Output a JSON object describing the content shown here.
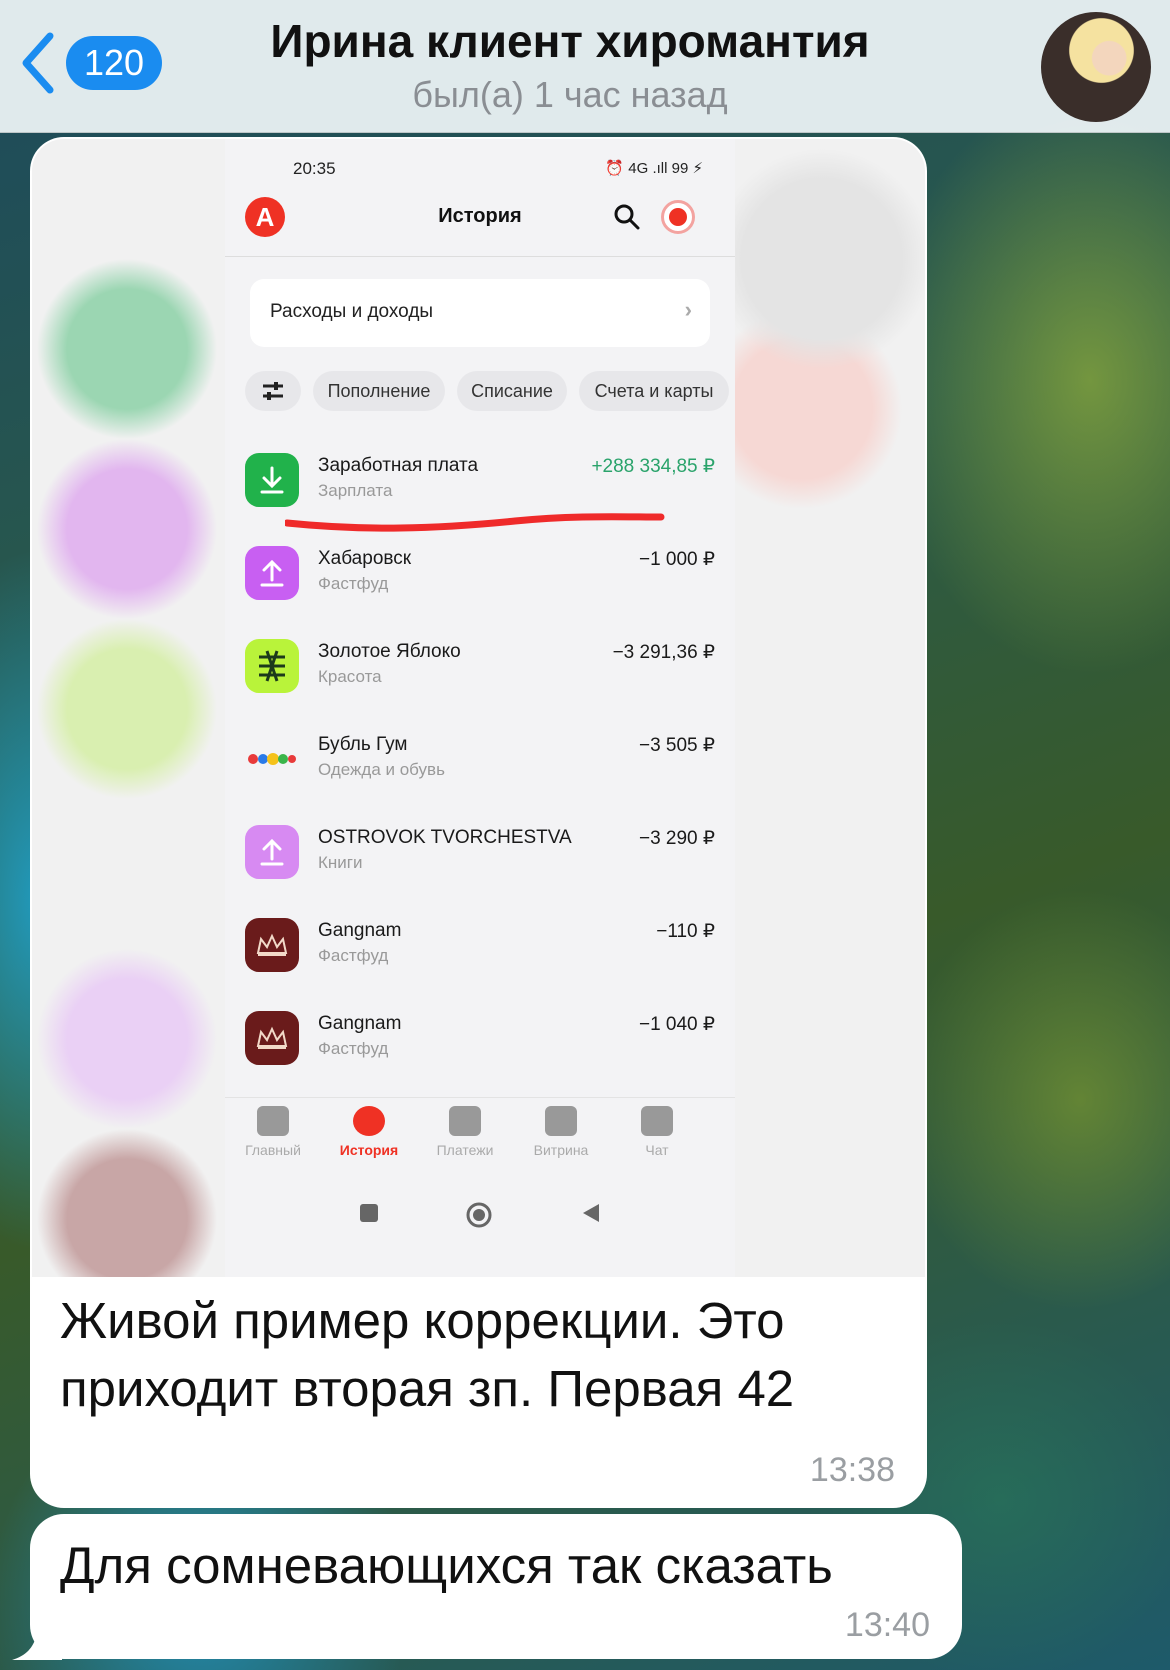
{
  "header": {
    "back_count": "120",
    "title": "Ирина клиент хиромантия",
    "status": "был(а) 1 час назад"
  },
  "phone": {
    "status_time": "20:35",
    "status_icons": "⏰ 4G .ıll 99 ⚡",
    "app_title": "История",
    "summary_card": "Расходы и доходы",
    "chips": [
      "Пополнение",
      "Списание",
      "Счета и карты"
    ],
    "transactions": [
      {
        "name": "Заработная плата",
        "category": "Зарплата",
        "amount": "+288 334,85 ₽",
        "icon": "download-icon",
        "color": "#21b24b"
      },
      {
        "name": "Хабаровск",
        "category": "Фастфуд",
        "amount": "−1 000 ₽",
        "icon": "upload-icon",
        "color": "#c85ff2"
      },
      {
        "name": "Золотое Яблоко",
        "category": "Красота",
        "amount": "−3 291,36 ₽",
        "icon": "golden-apple-logo",
        "color": "#b9f33a"
      },
      {
        "name": "Бубль Гум",
        "category": "Одежда и обувь",
        "amount": "−3 505 ₽",
        "icon": "bubblegum-logo",
        "color": "#ffffff"
      },
      {
        "name": "OSTROVOK TVORCHESTVA",
        "category": "Книги",
        "amount": "−3 290 ₽",
        "icon": "upload-icon",
        "color": "#d78af2"
      },
      {
        "name": "Gangnam",
        "category": "Фастфуд",
        "amount": "−110 ₽",
        "icon": "crown-icon",
        "color": "#6a1b1b"
      },
      {
        "name": "Gangnam",
        "category": "Фастфуд",
        "amount": "−1 040 ₽",
        "icon": "crown-icon",
        "color": "#6a1b1b"
      }
    ],
    "tabs": [
      {
        "label": "Главный",
        "icon": "home-icon"
      },
      {
        "label": "История",
        "icon": "clock-icon",
        "active": true
      },
      {
        "label": "Платежи",
        "icon": "ruble-icon"
      },
      {
        "label": "Витрина",
        "icon": "grid-icon"
      },
      {
        "label": "Чат",
        "icon": "chat-icon"
      }
    ]
  },
  "messages": [
    {
      "text": "Живой пример коррекции. Это приходит вторая зп. Первая 42",
      "time": "13:38"
    },
    {
      "text": "Для сомневающихся так сказать",
      "time": "13:40"
    }
  ],
  "colors": {
    "accent": "#1a8cf0",
    "alfa_red": "#ef3124",
    "income_green": "#2aa36b"
  }
}
